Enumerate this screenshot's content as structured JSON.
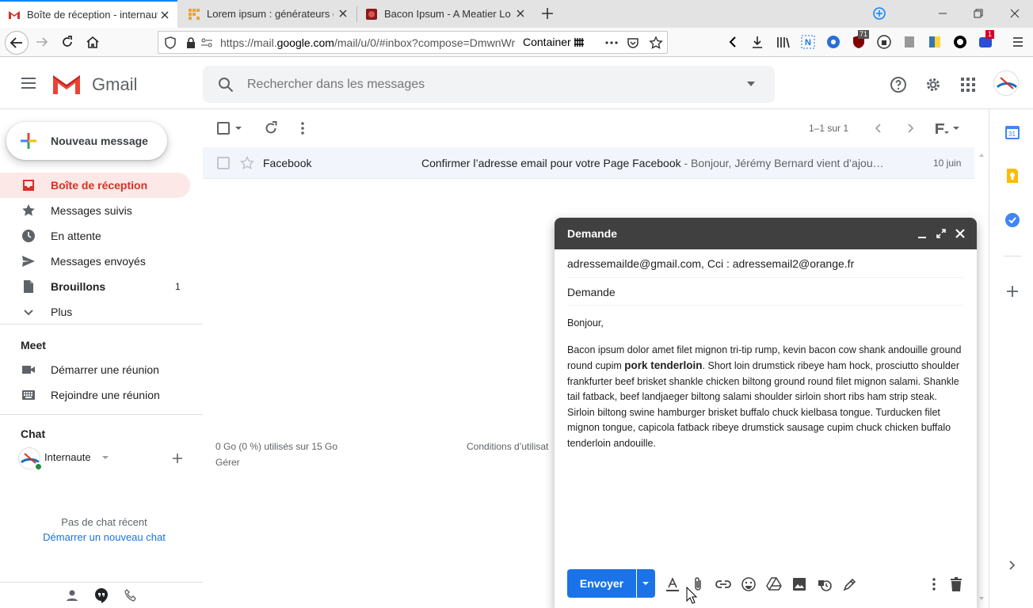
{
  "browser": {
    "tabs": [
      {
        "title": "Boîte de réception - internaute"
      },
      {
        "title": "Lorem ipsum : générateurs de f"
      },
      {
        "title": "Bacon Ipsum - A Meatier Lorem"
      }
    ],
    "url_prefix": "https://mail.",
    "url_domain": "google.com",
    "url_rest": "/mail/u/0/#inbox?compose=DmwnWr",
    "container_label": "Container",
    "ext_badge_1": "71",
    "ext_badge_2": "1"
  },
  "gmail": {
    "logo_text": "Gmail",
    "search_placeholder": "Rechercher dans les messages",
    "compose_button": "Nouveau message",
    "nav": [
      {
        "label": "Boîte de réception"
      },
      {
        "label": "Messages suivis"
      },
      {
        "label": "En attente"
      },
      {
        "label": "Messages envoyés"
      },
      {
        "label": "Brouillons",
        "count": "1"
      },
      {
        "label": "Plus"
      }
    ],
    "meet": {
      "title": "Meet",
      "start": "Démarrer une réunion",
      "join": "Rejoindre une réunion"
    },
    "chat": {
      "title": "Chat",
      "user": "Internaute",
      "empty": "Pas de chat récent",
      "start_link": "Démarrer un nouveau chat"
    },
    "toolbar": {
      "pagination": "1–1 sur 1"
    },
    "emails": [
      {
        "sender": "Facebook",
        "subject": "Confirmer l’adresse email pour votre Page Facebook",
        "snippet": " - Bonjour, Jérémy Bernard vient d’ajou…",
        "date": "10 juin"
      }
    ],
    "footer": {
      "storage": "0 Go (0 %) utilisés sur 15 Go",
      "manage": "Gérer",
      "terms": "Conditions d’utilisat"
    }
  },
  "compose": {
    "title": "Demande",
    "recipients": "adressemailde@gmail.com, Cci : adressemail2@orange.fr",
    "subject": "Demande",
    "greeting": "Bonjour,",
    "body_before": "Bacon ipsum dolor amet filet mignon tri-tip rump, kevin bacon cow shank andouille ground round cupim ",
    "body_bold": "pork tenderloin",
    "body_after": ". Short loin drumstick ribeye ham hock, prosciutto shoulder frankfurter beef brisket shankle chicken biltong ground round filet mignon salami. Shankle tail fatback, beef landjaeger biltong salami shoulder sirloin short ribs ham strip steak. Sirloin biltong swine hamburger brisket buffalo chuck kielbasa tongue. Turducken filet mignon tongue, capicola fatback ribeye drumstick sausage cupim chuck chicken buffalo tenderloin andouille.",
    "send_label": "Envoyer"
  },
  "colors": {
    "accent_red": "#d93025",
    "send_blue": "#1a73e8",
    "compose_header": "#404040",
    "firefox_blue": "#0a84ff"
  }
}
